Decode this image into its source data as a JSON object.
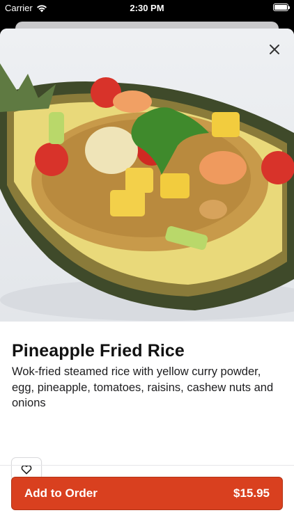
{
  "status_bar": {
    "carrier": "Carrier",
    "time": "2:30 PM"
  },
  "product": {
    "title": "Pineapple Fried Rice",
    "description": "Wok-fried steamed rice with yellow curry powder, egg, pineapple, tomatoes, raisins, cashew nuts and onions",
    "image_name": "pineapple-fried-rice-photo"
  },
  "actions": {
    "add_to_order_label": "Add to Order",
    "price": "$15.95"
  },
  "colors": {
    "accent": "#d9401f",
    "accent_border": "#b23315"
  }
}
